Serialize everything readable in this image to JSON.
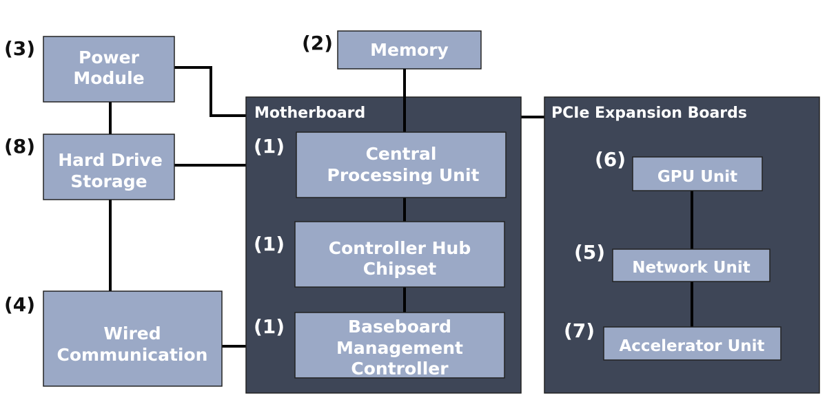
{
  "nodes": {
    "power": {
      "line1": "Power",
      "line2": "Module",
      "tag": "(3)"
    },
    "storage": {
      "line1": "Hard Drive",
      "line2": "Storage",
      "tag": "(8)"
    },
    "wired": {
      "line1": "Wired",
      "line2": "Communication",
      "tag": "(4)"
    },
    "memory": {
      "label": "Memory",
      "tag": "(2)"
    },
    "motherboard": {
      "label": "Motherboard"
    },
    "cpu": {
      "line1": "Central",
      "line2": "Processing Unit",
      "tag": "(1)"
    },
    "hub": {
      "line1": "Controller Hub",
      "line2": "Chipset",
      "tag": "(1)"
    },
    "bmc": {
      "line1": "Baseboard",
      "line2": "Management",
      "line3": "Controller",
      "tag": "(1)"
    },
    "pcie": {
      "label": "PCIe Expansion Boards"
    },
    "gpu": {
      "label": "GPU Unit",
      "tag": "(6)"
    },
    "network": {
      "label": "Network Unit",
      "tag": "(5)"
    },
    "accelerator": {
      "label": "Accelerator Unit",
      "tag": "(7)"
    }
  },
  "colors": {
    "box": "#9ba9c6",
    "panel": "#3e4657",
    "connector": "#000000"
  }
}
